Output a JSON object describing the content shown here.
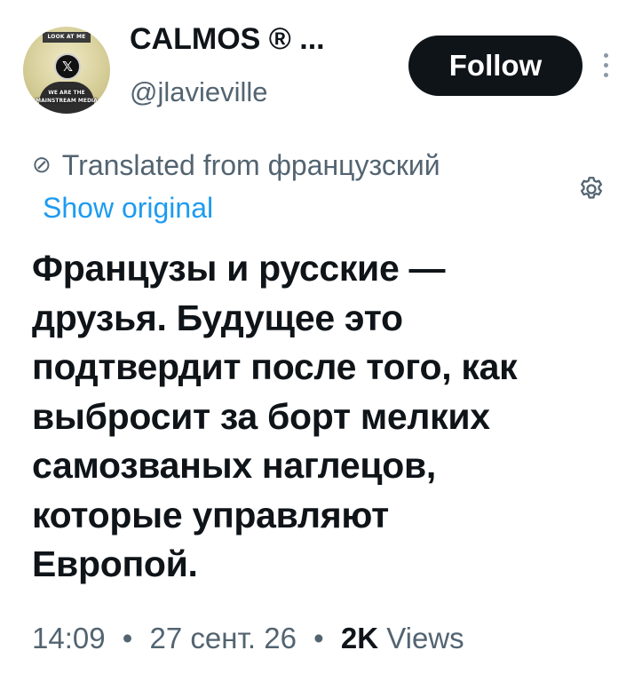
{
  "author": {
    "display_name": "CALMOS ® ...",
    "handle": "@jlavieville",
    "avatar": {
      "top_caption": "LOOK AT ME",
      "center_icon": "x-logo-icon",
      "center_glyph": "𝕏",
      "bottom_caption": "WE ARE THE MAINSTREAM MEDIA"
    }
  },
  "actions": {
    "follow_label": "Follow",
    "more_icon": "more-vertical-icon"
  },
  "translation": {
    "icon": "translate-icon",
    "icon_glyph": "⊘",
    "label": "Translated from французский",
    "show_original_label": "Show original",
    "settings_icon": "gear-icon"
  },
  "tweet": {
    "text": "Французы и русские —\nдрузья. Будущее это\nподтвердит после того, как\nвыбросит за борт мелких\nсамозваных наглецов,\nкоторые управляют\nЕвропой."
  },
  "meta": {
    "time": "14:09",
    "date": "27 сент. 26",
    "separator": "•",
    "views_count": "2K",
    "views_label": "Views"
  },
  "colors": {
    "text_primary": "#0f1419",
    "text_secondary": "#536471",
    "link": "#1d9bf0",
    "button_bg": "#0f1419",
    "button_text": "#ffffff"
  }
}
